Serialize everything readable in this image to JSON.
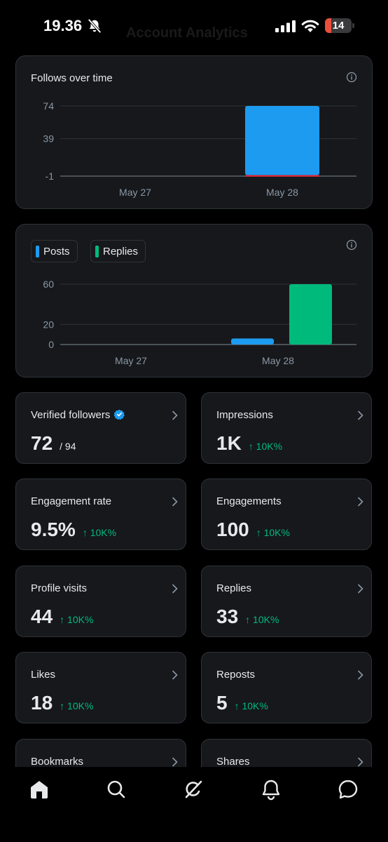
{
  "status_bar": {
    "time": "19.36",
    "battery": "14",
    "battery_color": "#eb4e3d"
  },
  "header": {
    "title": "Account Analytics"
  },
  "follows_chart": {
    "title": "Follows over time",
    "chart_data": {
      "type": "bar",
      "categories": [
        "May 27",
        "May 28"
      ],
      "series": [
        {
          "values": [
            0,
            74
          ],
          "color": "#1d9bf0"
        },
        {
          "values": [
            0,
            -1
          ],
          "color": "#f4212e"
        }
      ],
      "ytick_labels": [
        "74",
        "39",
        "-1"
      ],
      "ytick_values": [
        74,
        39,
        -1
      ],
      "ylim": [
        -1,
        74
      ],
      "grid": true
    }
  },
  "posts_chart": {
    "legend": [
      {
        "name": "Posts",
        "color": "#1d9bf0"
      },
      {
        "name": "Replies",
        "color": "#00ba7c"
      }
    ],
    "chart_data": {
      "type": "bar",
      "categories": [
        "May 27",
        "May 28"
      ],
      "series": [
        {
          "name": "Posts",
          "values": [
            0,
            6
          ],
          "color": "#1d9bf0"
        },
        {
          "name": "Replies",
          "values": [
            0,
            60
          ],
          "color": "#00ba7c"
        }
      ],
      "ytick_labels": [
        "60",
        "20",
        "0"
      ],
      "ytick_values": [
        60,
        20,
        0
      ],
      "ylim": [
        0,
        60
      ],
      "grid": true,
      "legend_position": "top-left"
    }
  },
  "metrics": [
    {
      "label": "Verified followers",
      "value": "72",
      "sub": "/ 94",
      "change": ""
    },
    {
      "label": "Impressions",
      "value": "1K",
      "sub": "",
      "change": "↑ 10K%"
    },
    {
      "label": "Engagement rate",
      "value": "9.5%",
      "sub": "",
      "change": "↑ 10K%"
    },
    {
      "label": "Engagements",
      "value": "100",
      "sub": "",
      "change": "↑ 10K%"
    },
    {
      "label": "Profile visits",
      "value": "44",
      "sub": "",
      "change": "↑ 10K%"
    },
    {
      "label": "Replies",
      "value": "33",
      "sub": "",
      "change": "↑ 10K%"
    },
    {
      "label": "Likes",
      "value": "18",
      "sub": "",
      "change": "↑ 10K%"
    },
    {
      "label": "Reposts",
      "value": "5",
      "sub": "",
      "change": "↑ 10K%"
    },
    {
      "label": "Bookmarks",
      "value": "",
      "sub": "",
      "change": ""
    },
    {
      "label": "Shares",
      "value": "",
      "sub": "",
      "change": ""
    }
  ],
  "tabbar": {
    "icons": [
      "home-icon",
      "search-icon",
      "grok-icon",
      "notifications-icon",
      "messages-icon"
    ]
  }
}
